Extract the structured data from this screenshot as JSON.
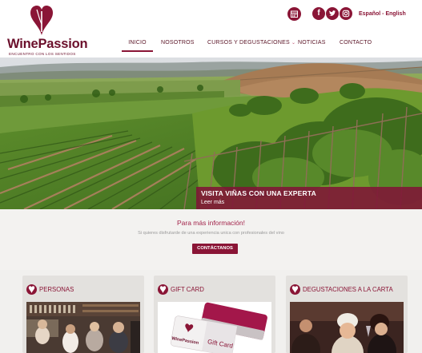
{
  "brand": {
    "name_part1": "Wine",
    "name_part2": "Passion",
    "tagline": "ENCUENTRO CON LOS SENTIDOS"
  },
  "header": {
    "icons": [
      "calendar-icon",
      "facebook-icon",
      "twitter-icon",
      "instagram-icon"
    ],
    "languages": "Español - English"
  },
  "nav": {
    "items": [
      {
        "label": "INICIO",
        "active": true
      },
      {
        "label": "NOSOTROS",
        "active": false
      },
      {
        "label": "CURSOS Y DEGUSTACIONES",
        "active": false
      },
      {
        "label": "NOTICIAS",
        "active": false
      },
      {
        "label": "CONTACTO",
        "active": false
      }
    ]
  },
  "hero": {
    "title": "VISITA VIÑAS CON UNA EXPERTA",
    "link": "Leer más"
  },
  "info": {
    "title": "Para más información!",
    "text": "Si quieres disfrutarde de una experiencia unica con profesionales del vino",
    "button": "CONTÁCTANOS"
  },
  "cards": [
    {
      "title": "PERSONAS"
    },
    {
      "title": "GIFT CARD"
    },
    {
      "title": "DEGUSTACIONES A LA CARTA"
    }
  ],
  "giftcard_art": {
    "brand": "WinePassion",
    "label": "Gift Card"
  },
  "colors": {
    "accent": "#8a1536",
    "text": "#5a1426",
    "background": "#f1f0ee"
  }
}
